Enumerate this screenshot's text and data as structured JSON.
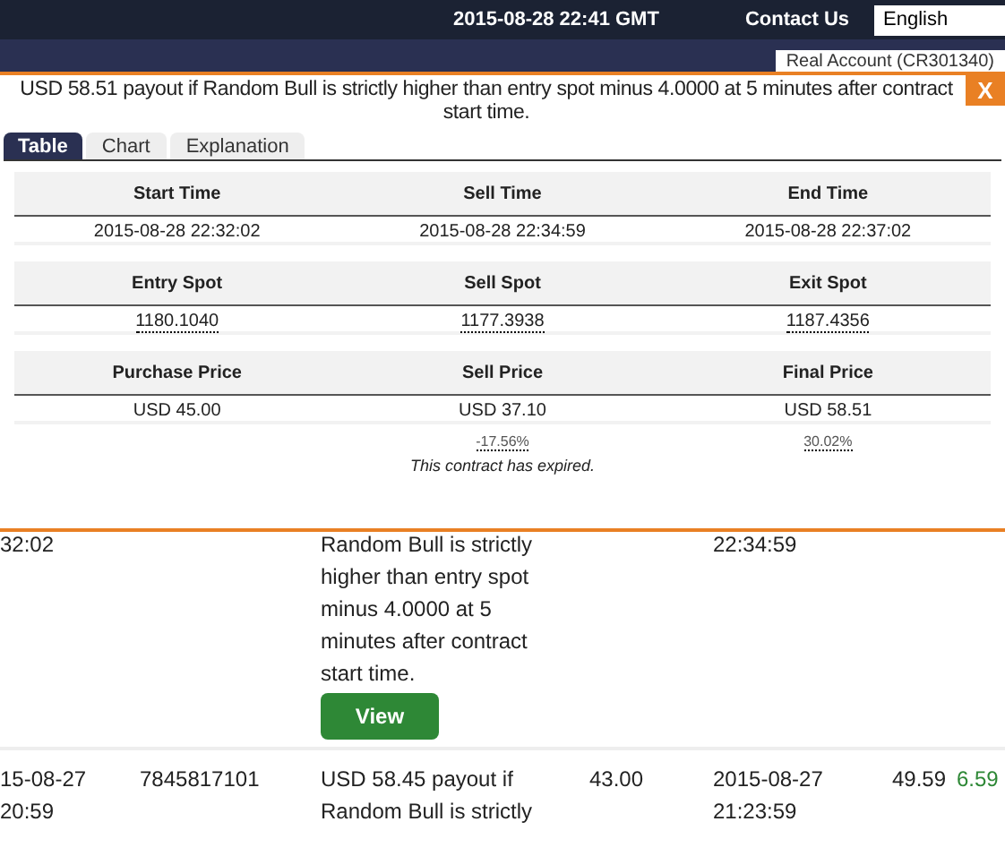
{
  "top_bar": {
    "clock": "2015-08-28 22:41 GMT",
    "contact": "Contact Us",
    "language": "English"
  },
  "header": {
    "account": "Real Account (CR301340)"
  },
  "dialog": {
    "title": "USD 58.51 payout if Random Bull is strictly higher than entry spot minus 4.0000 at 5 minutes after contract start time.",
    "close": "X",
    "tabs": [
      {
        "label": "Table",
        "selected": true
      },
      {
        "label": "Chart",
        "selected": false
      },
      {
        "label": "Explanation",
        "selected": false
      }
    ],
    "sections": [
      {
        "columns": [
          "Start Time",
          "Sell Time",
          "End Time"
        ],
        "values": [
          {
            "text": "2015-08-28 22:32:02",
            "underlined": false
          },
          {
            "text": "2015-08-28 22:34:59",
            "underlined": false
          },
          {
            "text": "2015-08-28 22:37:02",
            "underlined": false
          }
        ]
      },
      {
        "columns": [
          "Entry Spot",
          "Sell Spot",
          "Exit Spot"
        ],
        "values": [
          {
            "text": "1180.1040",
            "underlined": true
          },
          {
            "text": "1177.3938",
            "underlined": true
          },
          {
            "text": "1187.4356",
            "underlined": true
          }
        ]
      },
      {
        "columns": [
          "Purchase Price",
          "Sell Price",
          "Final Price"
        ],
        "values": [
          {
            "text": "USD 45.00",
            "underlined": false
          },
          {
            "text": "USD 37.10",
            "underlined": false,
            "change": "-17.56%"
          },
          {
            "text": "USD 58.51",
            "underlined": false,
            "change": "30.02%"
          }
        ]
      }
    ],
    "status": "This contract has expired."
  },
  "table": {
    "rows": [
      {
        "cells": [
          "32:02",
          null,
          "Random Bull is strictly higher than entry spot minus 4.0000 at 5 minutes after contract start time.",
          null,
          "22:34:59"
        ],
        "button": "View"
      },
      {
        "cells": [
          "15-08-27 20:59",
          "7845817101",
          "USD 58.45 payout if Random Bull is strictly",
          "43.00",
          "2015-08-27 21:23:59",
          "49.59",
          "6.59"
        ]
      }
    ]
  }
}
